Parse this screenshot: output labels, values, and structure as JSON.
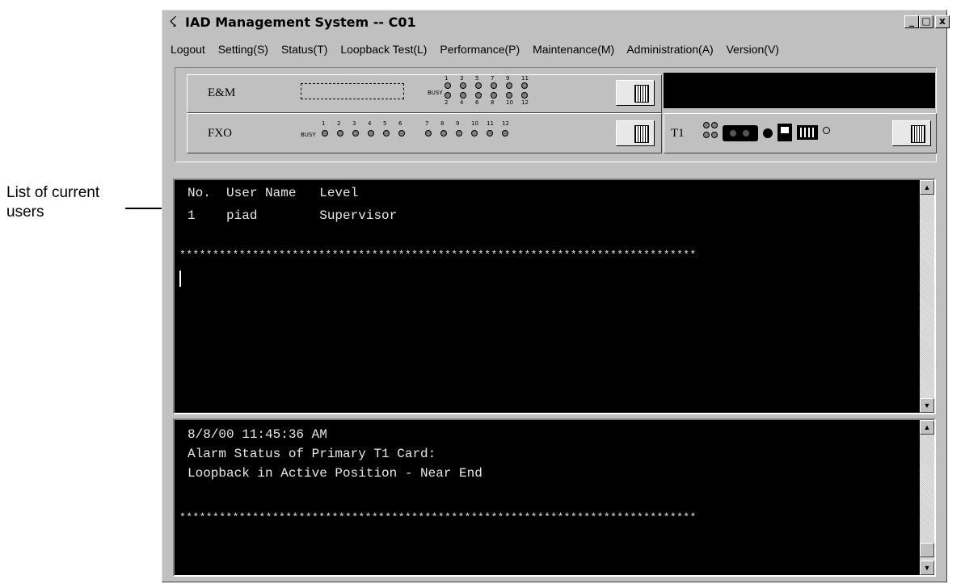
{
  "annotation": {
    "line1": "List of current",
    "line2": "users"
  },
  "window": {
    "title": "IAD Management System -- C01",
    "app_icon": "network-icon",
    "controls": {
      "minimize": "_",
      "maximize": "□",
      "close": "x"
    }
  },
  "menu": [
    {
      "label": "Logout"
    },
    {
      "label": "Setting(S)"
    },
    {
      "label": "Status(T)"
    },
    {
      "label": "Loopback Test(L)"
    },
    {
      "label": "Performance(P)"
    },
    {
      "label": "Maintenance(M)"
    },
    {
      "label": "Administration(A)"
    },
    {
      "label": "Version(V)"
    }
  ],
  "panel": {
    "em_label": "E&M",
    "em_busy": "BUSY",
    "em_top_nums": [
      "1",
      "3",
      "5",
      "7",
      "9",
      "11"
    ],
    "em_bottom_nums": [
      "2",
      "4",
      "6",
      "8",
      "10",
      "12"
    ],
    "fxo_label": "FXO",
    "fxo_busy": "BUSY",
    "fxo_nums": [
      "1",
      "2",
      "3",
      "4",
      "5",
      "6",
      "7",
      "8",
      "9",
      "10",
      "11",
      "12"
    ],
    "t1_label": "T1"
  },
  "users_terminal": {
    "header": "No.  User Name   Level",
    "row": "1    piad        Supervisor",
    "separator": "******************************************************************************"
  },
  "alarm_terminal": {
    "timestamp": "8/8/00 11:45:36 AM",
    "line1": "Alarm Status of Primary T1 Card:",
    "line2": "Loopback in Active Position - Near End",
    "separator": "******************************************************************************"
  },
  "colors": {
    "window_bg": "#c0c0c0",
    "terminal_bg": "#000000",
    "terminal_fg": "#e8e8e8"
  }
}
